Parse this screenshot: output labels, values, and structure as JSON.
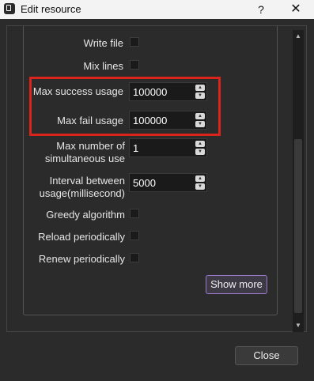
{
  "window": {
    "title": "Edit resource",
    "help": "?",
    "close": "✕"
  },
  "form": {
    "write_file": "Write file",
    "mix_lines": "Mix lines",
    "max_success_label": "Max success usage",
    "max_success_value": "100000",
    "max_fail_label": "Max fail usage",
    "max_fail_value": "100000",
    "max_simul_label_1": "Max number of",
    "max_simul_label_2": "simultaneous use",
    "max_simul_value": "1",
    "interval_label_1": "Interval between",
    "interval_label_2": "usage(millisecond)",
    "interval_value": "5000",
    "greedy": "Greedy algorithm",
    "reload": "Reload periodically",
    "renew": "Renew periodically",
    "show_more": "Show more"
  },
  "footer": {
    "close": "Close"
  },
  "colors": {
    "highlight": "#d9241b",
    "accent_border": "#9b78c9"
  }
}
